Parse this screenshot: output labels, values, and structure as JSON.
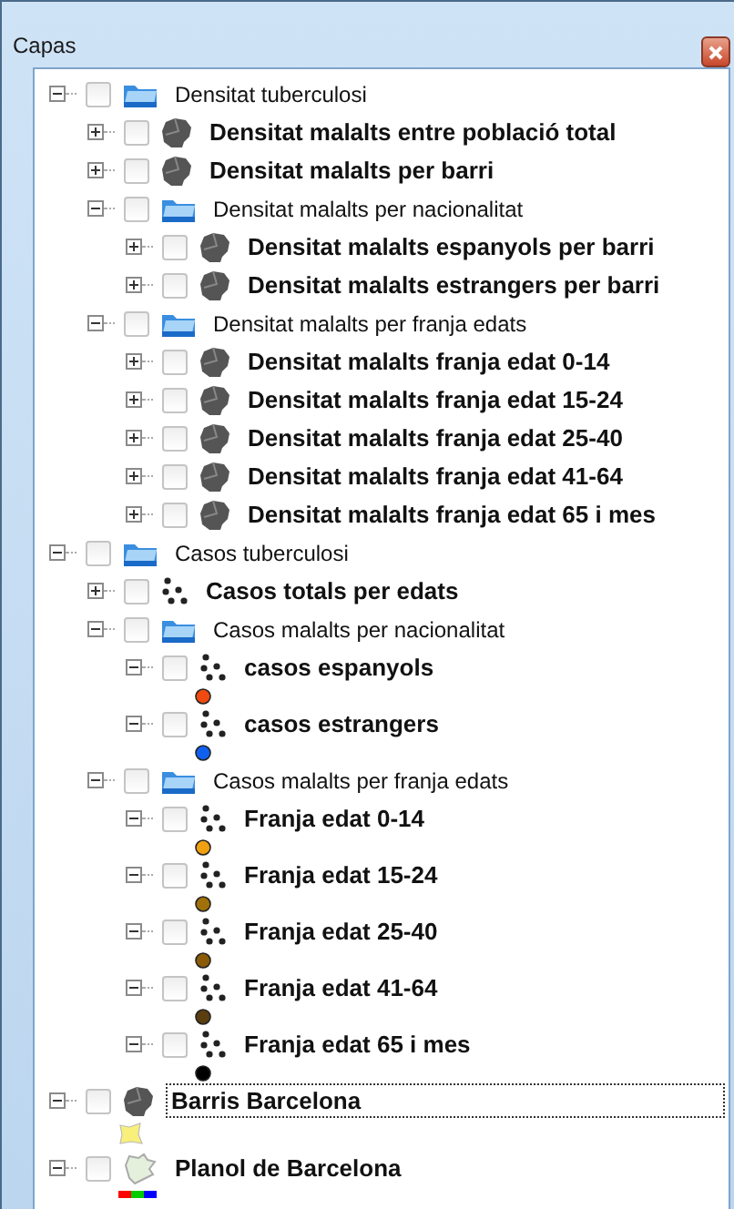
{
  "window": {
    "title": "Capas"
  },
  "layers": [
    {
      "label": "Densitat tuberculosi",
      "kind": "group",
      "checked": false,
      "expanded": true,
      "selected": false,
      "children": [
        {
          "label": "Densitat malalts entre població total",
          "kind": "polygon",
          "checked": false,
          "expanded": false,
          "selected": false
        },
        {
          "label": "Densitat malalts per barri",
          "kind": "polygon",
          "checked": false,
          "expanded": false,
          "selected": false
        },
        {
          "label": "Densitat malalts per nacionalitat",
          "kind": "group",
          "checked": false,
          "expanded": true,
          "selected": false,
          "children": [
            {
              "label": "Densitat malalts espanyols per barri",
              "kind": "polygon",
              "checked": false,
              "expanded": false,
              "selected": false
            },
            {
              "label": "Densitat malalts estrangers per barri",
              "kind": "polygon",
              "checked": false,
              "expanded": false,
              "selected": false
            }
          ]
        },
        {
          "label": "Densitat malalts per franja edats",
          "kind": "group",
          "checked": false,
          "expanded": true,
          "selected": false,
          "children": [
            {
              "label": "Densitat malalts franja edat 0-14",
              "kind": "polygon",
              "checked": false,
              "expanded": false,
              "selected": false
            },
            {
              "label": "Densitat malalts franja edat 15-24",
              "kind": "polygon",
              "checked": false,
              "expanded": false,
              "selected": false
            },
            {
              "label": "Densitat malalts franja edat 25-40",
              "kind": "polygon",
              "checked": false,
              "expanded": false,
              "selected": false
            },
            {
              "label": "Densitat malalts franja edat 41-64",
              "kind": "polygon",
              "checked": false,
              "expanded": false,
              "selected": false
            },
            {
              "label": "Densitat malalts franja edat 65 i mes",
              "kind": "polygon",
              "checked": false,
              "expanded": false,
              "selected": false
            }
          ]
        }
      ]
    },
    {
      "label": "Casos tuberculosi",
      "kind": "group",
      "checked": false,
      "expanded": true,
      "selected": false,
      "children": [
        {
          "label": "Casos totals per edats",
          "kind": "points",
          "checked": false,
          "expanded": false,
          "selected": false
        },
        {
          "label": "Casos malalts per nacionalitat",
          "kind": "group",
          "checked": false,
          "expanded": true,
          "selected": false,
          "children": [
            {
              "label": "casos espanyols",
              "kind": "points",
              "checked": false,
              "expanded": true,
              "selected": false,
              "legend": {
                "kind": "dot",
                "color": "#f04a10"
              }
            },
            {
              "label": "casos estrangers",
              "kind": "points",
              "checked": false,
              "expanded": true,
              "selected": false,
              "legend": {
                "kind": "dot",
                "color": "#1060f0"
              }
            }
          ]
        },
        {
          "label": "Casos malalts per franja edats",
          "kind": "group",
          "checked": false,
          "expanded": true,
          "selected": false,
          "children": [
            {
              "label": "Franja edat 0-14",
              "kind": "points",
              "checked": false,
              "expanded": true,
              "selected": false,
              "legend": {
                "kind": "dot",
                "color": "#f0a010"
              }
            },
            {
              "label": "Franja edat 15-24",
              "kind": "points",
              "checked": false,
              "expanded": true,
              "selected": false,
              "legend": {
                "kind": "dot",
                "color": "#a0700a"
              }
            },
            {
              "label": "Franja edat 25-40",
              "kind": "points",
              "checked": false,
              "expanded": true,
              "selected": false,
              "legend": {
                "kind": "dot",
                "color": "#8a5c08"
              }
            },
            {
              "label": "Franja edat 41-64",
              "kind": "points",
              "checked": false,
              "expanded": true,
              "selected": false,
              "legend": {
                "kind": "dot",
                "color": "#5a3e10"
              }
            },
            {
              "label": "Franja edat 65 i mes",
              "kind": "points",
              "checked": false,
              "expanded": true,
              "selected": false,
              "legend": {
                "kind": "dot",
                "color": "#000000"
              }
            }
          ]
        }
      ]
    },
    {
      "label": "Barris Barcelona",
      "kind": "polygon",
      "checked": false,
      "expanded": true,
      "selected": true,
      "legend": {
        "kind": "fill",
        "color": "#f8f07a"
      }
    },
    {
      "label": "Planol de Barcelona",
      "kind": "raster",
      "checked": false,
      "expanded": true,
      "selected": false,
      "legend": {
        "kind": "bands"
      }
    }
  ]
}
